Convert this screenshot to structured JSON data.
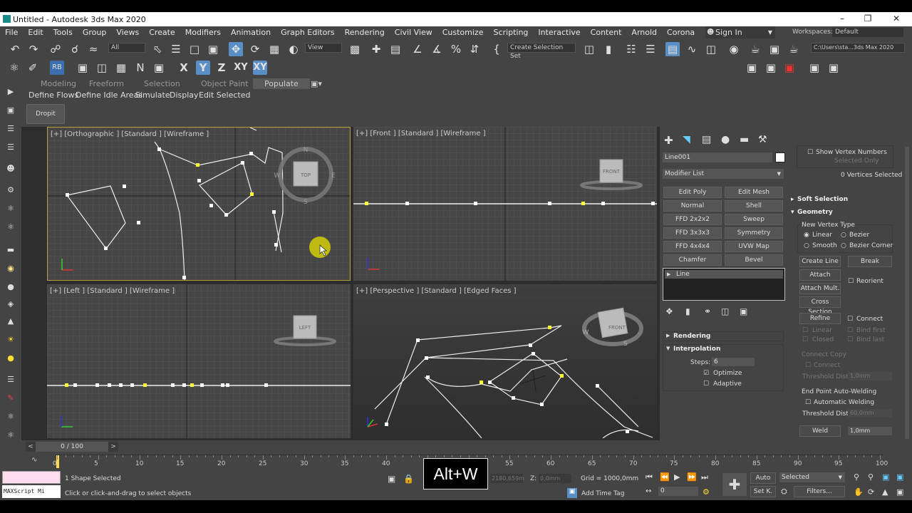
{
  "window": {
    "title": "Untitled - Autodesk 3ds Max 2020"
  },
  "menu": [
    "File",
    "Edit",
    "Tools",
    "Group",
    "Views",
    "Create",
    "Modifiers",
    "Animation",
    "Graph Editors",
    "Rendering",
    "Civil View",
    "Customize",
    "Scripting",
    "Interactive",
    "Content",
    "Arnold",
    "Corona",
    "Help"
  ],
  "signin": "Sign In",
  "workspaces": {
    "label": "Workspaces:",
    "value": "Default"
  },
  "toolbar": {
    "filter": "All",
    "refcoord": "View",
    "selset": "Create Selection Set",
    "path": "C:\\Users\\sta...3ds Max 2020"
  },
  "ribbon": {
    "tabs": [
      "Modeling",
      "Freeform",
      "Selection",
      "Object Paint",
      "Populate"
    ],
    "active": "Populate"
  },
  "populate": {
    "tabs": [
      "Define Flows",
      "Define Idle Areas",
      "Simulate",
      "Display",
      "Edit Selected"
    ],
    "dropit": "Dropit"
  },
  "viewports": [
    {
      "label": "[+] [Orthographic ] [Standard ] [Wireframe ]"
    },
    {
      "label": "[+] [Front ] [Standard ] [Wireframe ]"
    },
    {
      "label": "[+] [Left ] [Standard ] [Wireframe ]"
    },
    {
      "label": "[+] [Perspective ] [Standard ] [Edged Faces ]"
    }
  ],
  "viewcube": {
    "top": "TOP",
    "front": "FRONT",
    "left": "LEFT",
    "n": "N",
    "s": "S",
    "e": "E",
    "w": "W"
  },
  "cmd": {
    "object_name": "Line001",
    "modifier_list": "Modifier List",
    "mod_buttons": [
      "Edit Poly",
      "Edit Mesh",
      "Normal",
      "Shell",
      "FFD 2x2x2",
      "Sweep",
      "FFD 3x3x3",
      "Symmetry",
      "FFD 4x4x4",
      "UVW Map",
      "Chamfer",
      "Bevel"
    ],
    "stack_item": "Line",
    "rendering": "Rendering",
    "interpolation": "Interpolation",
    "steps_label": "Steps:",
    "steps": "6",
    "optimize": "Optimize",
    "adaptive": "Adaptive"
  },
  "geom": {
    "show_vertex_numbers": "Show Vertex Numbers",
    "selected_only": "Selected Only",
    "vertices_selected": "0 Vertices Selected",
    "soft_selection": "Soft Selection",
    "geometry": "Geometry",
    "new_vertex_type": "New Vertex Type",
    "linear": "Linear",
    "bezier": "Bezier",
    "smooth": "Smooth",
    "bezier_corner": "Bezier Corner",
    "create_line": "Create Line",
    "break": "Break",
    "attach": "Attach",
    "reorient": "Reorient",
    "attach_mult": "Attach Mult.",
    "cross_section": "Cross Section",
    "refine": "Refine",
    "connect": "Connect",
    "linear2": "Linear",
    "bind_first": "Bind first",
    "closed": "Closed",
    "bind_last": "Bind last",
    "connect_copy": "Connect Copy",
    "connect2": "Connect",
    "threshold_dist": "Threshold Dist.",
    "threshold_val": "1,0mm",
    "end_point": "End Point Auto-Welding",
    "automatic_welding": "Automatic Welding",
    "threshold_dist2": "Threshold Dist.",
    "threshold_val2": "60,0mm",
    "weld": "Weld",
    "weld_val": "1,0mm"
  },
  "timeline": {
    "frame": "0 / 100",
    "ticks": [
      "0",
      "5",
      "10",
      "15",
      "20",
      "25",
      "30",
      "35",
      "40",
      "45",
      "50",
      "55",
      "60",
      "65",
      "70",
      "75",
      "80",
      "85",
      "90",
      "95",
      "100"
    ]
  },
  "status": {
    "maxscript": "MAXScript Mi",
    "selected": "1 Shape Selected",
    "hint": "Click or click-and-drag to select objects",
    "x_val": "2180,659m",
    "z_label": "Z:",
    "z_val": "0,0mm",
    "grid": "Grid = 1000,0mm",
    "add_time_tag": "Add Time Tag",
    "auto": "Auto",
    "selected_dd": "Selected",
    "setk": "Set K.",
    "filters": "Filters...",
    "frame_field": "0"
  },
  "shortcut_overlay": "Alt+W"
}
